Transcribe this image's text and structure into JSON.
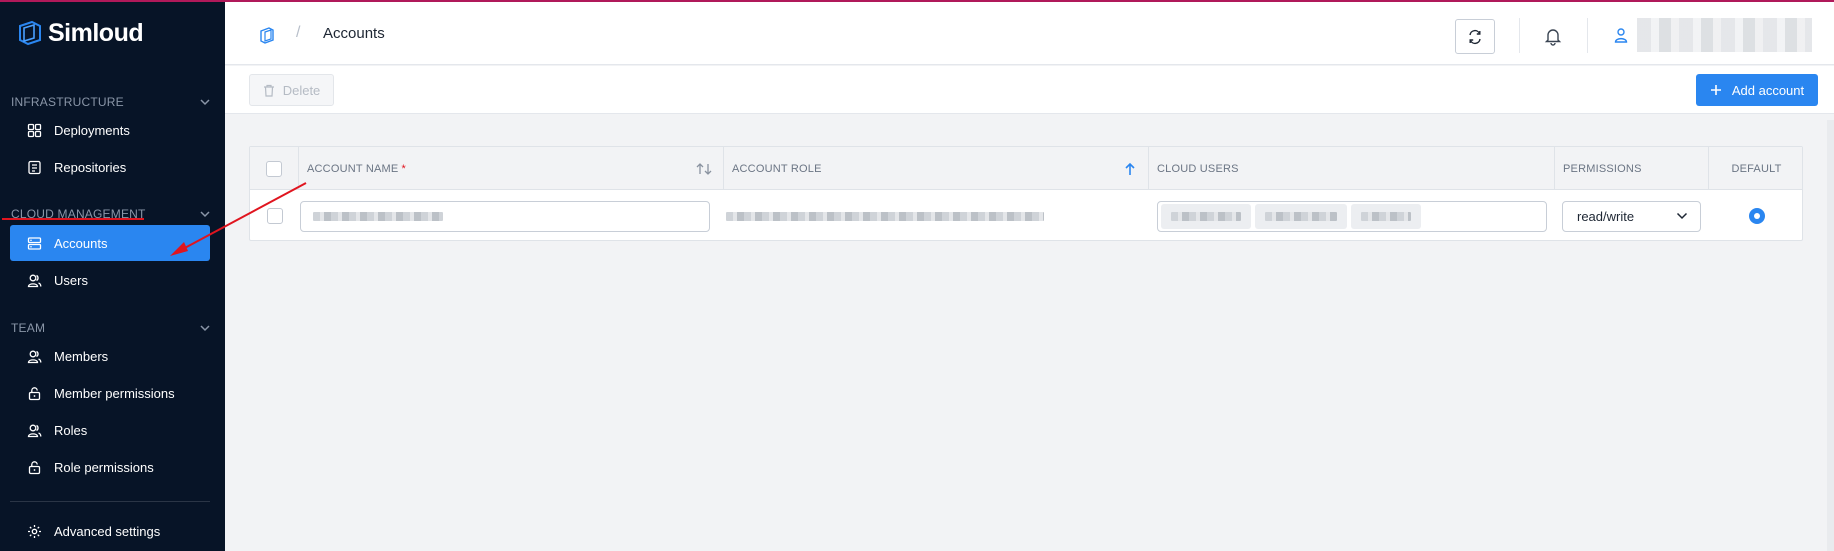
{
  "app": {
    "name": "Simloud"
  },
  "colors": {
    "sidebar_bg": "#071427",
    "accent": "#2a86f0",
    "annotation": "#e0151f",
    "top_border": "#b0195a"
  },
  "sidebar": {
    "sections": [
      {
        "title": "INFRASTRUCTURE",
        "items": [
          {
            "label": "Deployments",
            "icon": "grid-icon"
          },
          {
            "label": "Repositories",
            "icon": "document-icon"
          }
        ]
      },
      {
        "title": "CLOUD MANAGEMENT",
        "items": [
          {
            "label": "Accounts",
            "icon": "server-icon",
            "active": true
          },
          {
            "label": "Users",
            "icon": "users-icon"
          }
        ]
      },
      {
        "title": "TEAM",
        "items": [
          {
            "label": "Members",
            "icon": "users-icon"
          },
          {
            "label": "Member permissions",
            "icon": "lock-icon"
          },
          {
            "label": "Roles",
            "icon": "users-icon"
          },
          {
            "label": "Role permissions",
            "icon": "lock-icon"
          }
        ]
      }
    ],
    "footer_item": {
      "label": "Advanced settings",
      "icon": "gear-icon"
    }
  },
  "header": {
    "breadcrumb_sep": "/",
    "page_title": "Accounts",
    "user_name_redacted": ""
  },
  "toolbar": {
    "delete_label": "Delete",
    "add_label": "Add account"
  },
  "table": {
    "columns": [
      "ACCOUNT NAME",
      "ACCOUNT ROLE",
      "CLOUD USERS",
      "PERMISSIONS",
      "DEFAULT"
    ],
    "required_mark": "*",
    "rows": [
      {
        "account_name": "",
        "account_role": "",
        "cloud_users": [
          "",
          "",
          ""
        ],
        "permissions": "read/write",
        "default": true
      }
    ]
  }
}
